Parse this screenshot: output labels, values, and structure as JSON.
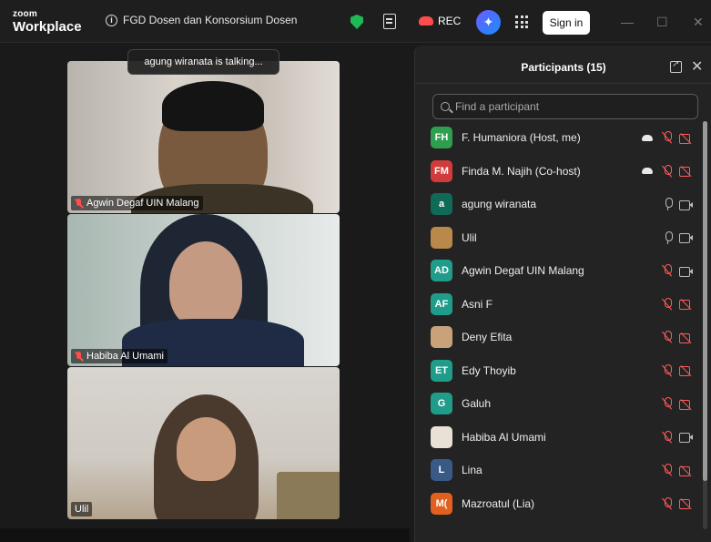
{
  "app": {
    "logo_line1": "zoom",
    "logo_line2": "Workplace",
    "meeting_title": "FGD Dosen dan Konsorsium Dosen",
    "rec_label": "REC",
    "signin_label": "Sign in"
  },
  "video": {
    "talking_banner": "agung wiranata is talking...",
    "tiles": [
      {
        "name": "Agwin Degaf UIN Malang",
        "muted": true
      },
      {
        "name": "Habiba Al Umami",
        "muted": true
      },
      {
        "name": "Ulil",
        "muted": false
      }
    ]
  },
  "participants": {
    "title": "Participants (15)",
    "search_placeholder": "Find a participant",
    "list": [
      {
        "initials": "FH",
        "name": "F. Humaniora (Host, me)",
        "color": "#2e9e4f",
        "cloud": true,
        "mic": "off",
        "video": "off"
      },
      {
        "initials": "FM",
        "name": "Finda M. Najih (Co-host)",
        "color": "#d23b3b",
        "cloud": true,
        "mic": "off",
        "video": "off"
      },
      {
        "initials": "a",
        "name": "agung wiranata",
        "color": "#0f6b57",
        "cloud": false,
        "mic": "on",
        "video": "on"
      },
      {
        "initials": "",
        "name": "Ulil",
        "color": "#b8894a",
        "cloud": false,
        "mic": "on",
        "video": "on"
      },
      {
        "initials": "AD",
        "name": "Agwin Degaf UIN Malang",
        "color": "#1f9c8a",
        "cloud": false,
        "mic": "off",
        "video": "on"
      },
      {
        "initials": "AF",
        "name": "Asni F",
        "color": "#1f9c8a",
        "cloud": false,
        "mic": "off",
        "video": "off"
      },
      {
        "initials": "",
        "name": "Deny Efita",
        "color": "#c9a27a",
        "cloud": false,
        "mic": "off",
        "video": "off"
      },
      {
        "initials": "ET",
        "name": "Edy Thoyib",
        "color": "#1f9c8a",
        "cloud": false,
        "mic": "off",
        "video": "off"
      },
      {
        "initials": "G",
        "name": "Galuh",
        "color": "#1f9c8a",
        "cloud": false,
        "mic": "off",
        "video": "off"
      },
      {
        "initials": "",
        "name": "Habiba Al Umami",
        "color": "#e9e1d6",
        "cloud": false,
        "mic": "off",
        "video": "on"
      },
      {
        "initials": "L",
        "name": "Lina",
        "color": "#3a5a86",
        "cloud": false,
        "mic": "off",
        "video": "off"
      },
      {
        "initials": "M(",
        "name": "Mazroatul (Lia)",
        "color": "#e2601f",
        "cloud": false,
        "mic": "off",
        "video": "off"
      }
    ]
  }
}
